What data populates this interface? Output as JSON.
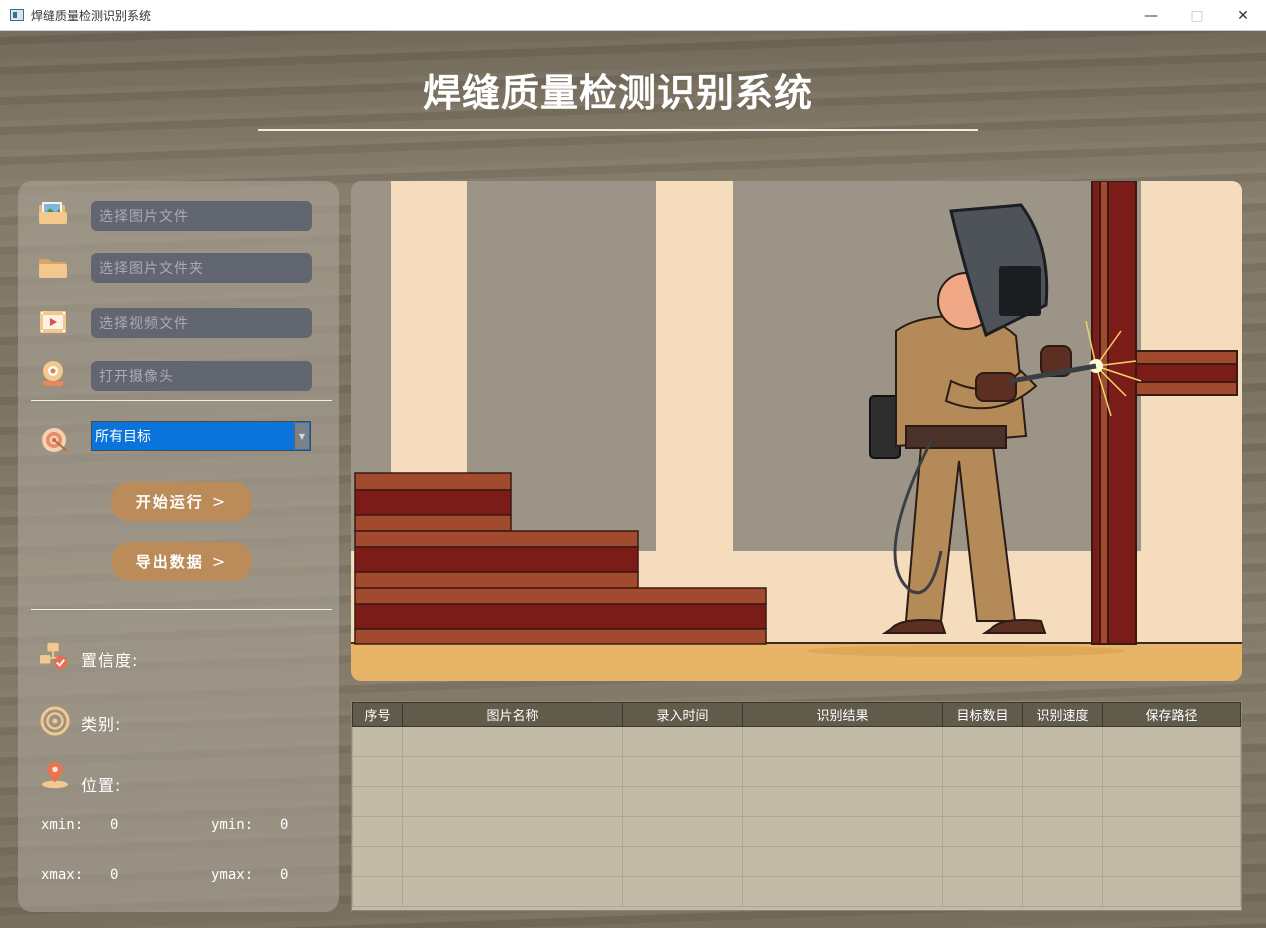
{
  "window": {
    "title": "焊缝质量检测识别系统"
  },
  "header": {
    "title": "焊缝质量检测识别系统"
  },
  "left_panel": {
    "image_file_placeholder": "选择图片文件",
    "image_folder_placeholder": "选择图片文件夹",
    "video_file_placeholder": "选择视频文件",
    "camera_placeholder": "打开摄像头",
    "target_select": {
      "selected": "所有目标"
    },
    "start_button": "开始运行",
    "export_button": "导出数据",
    "chevron": ">",
    "confidence_label": "置信度:",
    "class_label": "类别:",
    "position_label": "位置:",
    "xmin_label": "xmin:",
    "xmin_value": "0",
    "ymin_label": "ymin:",
    "ymin_value": "0",
    "xmax_label": "xmax:",
    "xmax_value": "0",
    "ymax_label": "ymax:",
    "ymax_value": "0"
  },
  "table": {
    "columns": [
      "序号",
      "图片名称",
      "录入时间",
      "识别结果",
      "目标数目",
      "识别速度",
      "保存路径"
    ],
    "empty_rows": 6
  },
  "colors": {
    "accent_button": "#bb8b5a",
    "select_highlight": "#0a74da",
    "table_header": "#615b4c",
    "table_body": "#c3bba8"
  },
  "icons": {
    "minimize": "minimize-icon",
    "maximize": "maximize-icon",
    "close": "close-icon",
    "image_file": "image-file-icon",
    "folder": "folder-icon",
    "video": "video-icon",
    "camera": "camera-icon",
    "target": "target-icon",
    "confidence": "confidence-icon",
    "class": "class-icon",
    "location": "location-pin-icon"
  }
}
